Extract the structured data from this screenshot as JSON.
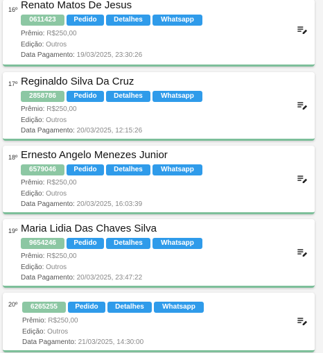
{
  "labels": {
    "premio": "Prêmio:",
    "edicao": "Edição:",
    "data_pagamento": "Data Pagamento:",
    "pedido": "Pedido",
    "detalhes": "Detalhes",
    "whatsapp": "Whatsapp"
  },
  "colors": {
    "code_badge": "#8cc7a3",
    "action_button": "#2f9bea",
    "card_accent": "#7dbf9a"
  },
  "icons": {
    "edit": "edit-note-icon"
  },
  "items": [
    {
      "rank": "16º",
      "name": "Renato Matos De Jesus",
      "code": "0611423",
      "premio": "R$250,00",
      "edicao": "Outros",
      "data_pagamento": "19/03/2025, 23:30:26"
    },
    {
      "rank": "17º",
      "name": "Reginaldo Silva Da Cruz",
      "code": "2858786",
      "premio": "R$250,00",
      "edicao": "Outros",
      "data_pagamento": "20/03/2025, 12:15:26"
    },
    {
      "rank": "18º",
      "name": "Ernesto Angelo Menezes Junior",
      "code": "6579046",
      "premio": "R$250,00",
      "edicao": "Outros",
      "data_pagamento": "20/03/2025, 16:03:39"
    },
    {
      "rank": "19º",
      "name": "Maria Lidia Das Chaves Silva",
      "code": "9654246",
      "premio": "R$250,00",
      "edicao": "Outros",
      "data_pagamento": "20/03/2025, 23:47:22"
    },
    {
      "rank": "20º",
      "name": "",
      "code": "6265255",
      "premio": "R$250,00",
      "edicao": "Outros",
      "data_pagamento": "21/03/2025, 14:30:00"
    }
  ]
}
